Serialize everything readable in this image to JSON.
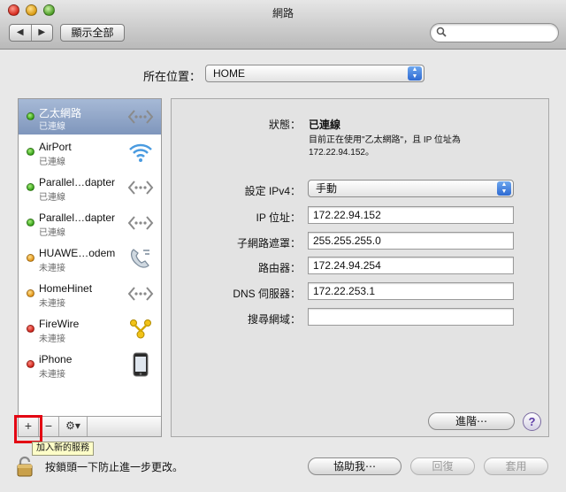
{
  "window": {
    "title": "網路"
  },
  "toolbar": {
    "back_label": "◀",
    "forward_label": "▶",
    "show_all_label": "顯示全部",
    "search_value": "",
    "search_placeholder": ""
  },
  "location": {
    "label": "所在位置：",
    "value": "HOME"
  },
  "services": [
    {
      "name": "乙太網路",
      "status": "已連線",
      "dot": "green",
      "icon": "ethernet-icon",
      "selected": true
    },
    {
      "name": "AirPort",
      "status": "已連線",
      "dot": "green",
      "icon": "wifi-icon",
      "selected": false
    },
    {
      "name": "Parallel…dapter",
      "status": "已連線",
      "dot": "green",
      "icon": "ethernet-icon",
      "selected": false
    },
    {
      "name": "Parallel…dapter",
      "status": "已連線",
      "dot": "green",
      "icon": "ethernet-icon",
      "selected": false
    },
    {
      "name": "HUAWE…odem",
      "status": "未連接",
      "dot": "yellow",
      "icon": "phone-modem-icon",
      "selected": false
    },
    {
      "name": "HomeHinet",
      "status": "未連接",
      "dot": "yellow",
      "icon": "ethernet-icon",
      "selected": false
    },
    {
      "name": "FireWire",
      "status": "未連接",
      "dot": "red",
      "icon": "firewire-icon",
      "selected": false
    },
    {
      "name": "iPhone",
      "status": "未連接",
      "dot": "red",
      "icon": "iphone-icon",
      "selected": false
    }
  ],
  "service_toolbar": {
    "add_label": "+",
    "remove_label": "−",
    "gear_label": "⚙▾",
    "add_tooltip": "加入新的服務"
  },
  "details": {
    "status_label": "狀態：",
    "status_value": "已連線",
    "status_description_1": "目前正在使用\"乙太網路\"，且 IP 位址為",
    "status_description_2": "172.22.94.152。",
    "ipv4_label": "設定 IPv4：",
    "ipv4_value": "手動",
    "ip_label": "IP 位址：",
    "ip_value": "172.22.94.152",
    "subnet_label": "子網路遮罩：",
    "subnet_value": "255.255.255.0",
    "router_label": "路由器：",
    "router_value": "172.24.94.254",
    "dns_label": "DNS 伺服器：",
    "dns_value": "172.22.253.1",
    "search_domain_label": "搜尋網域：",
    "search_domain_value": "",
    "advanced_label": "進階⋯",
    "help_label": "?"
  },
  "footer": {
    "lock_text": "按鎖頭一下防止進一步更改。",
    "assist_label": "協助我⋯",
    "revert_label": "回復",
    "apply_label": "套用"
  },
  "colors": {
    "highlight_red": "#e30613",
    "selected_row": "#8fa3c7",
    "status_green": "#2f9b12",
    "status_yellow": "#e08d0e",
    "status_red": "#c91b12"
  }
}
